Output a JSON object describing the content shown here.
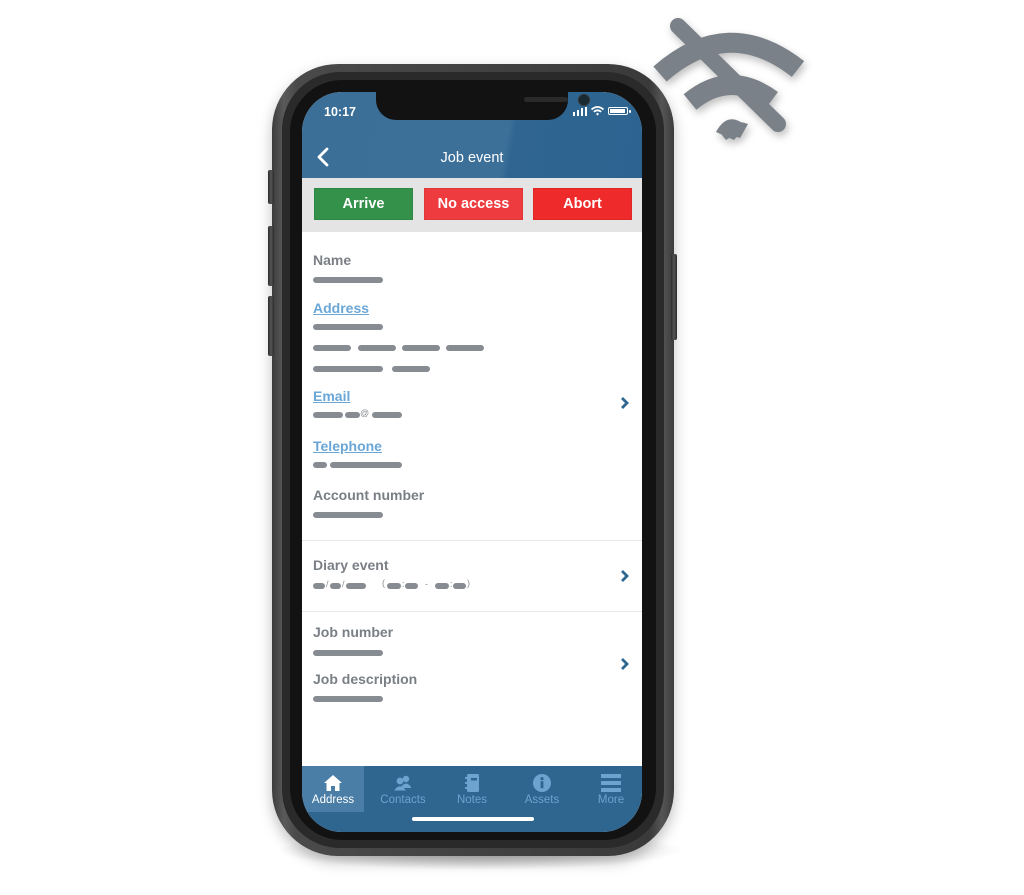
{
  "status_bar": {
    "time": "10:17",
    "icons": [
      "cellular-signal-icon",
      "wifi-icon",
      "battery-icon"
    ]
  },
  "header": {
    "title": "Job event",
    "back_icon": "chevron-left-icon"
  },
  "actions": {
    "arrive": {
      "label": "Arrive",
      "color": "#33914a"
    },
    "no_access": {
      "label": "No access",
      "color": "#ee3b3f"
    },
    "abort": {
      "label": "Abort",
      "color": "#ee2a2a"
    }
  },
  "fields": {
    "name": {
      "label": "Name"
    },
    "address": {
      "label": "Address"
    },
    "email": {
      "label": "Email",
      "at_symbol": "@"
    },
    "telephone": {
      "label": "Telephone"
    },
    "account_number": {
      "label": "Account number"
    },
    "diary_event": {
      "label": "Diary event",
      "open_paren": "(",
      "close_paren": ")",
      "dash": "-",
      "slash": "/",
      "colon": ":"
    },
    "job_number": {
      "label": "Job number"
    },
    "job_description": {
      "label": "Job description"
    }
  },
  "tabbar": {
    "tabs": [
      {
        "label": "Address",
        "icon": "home-icon",
        "active": true
      },
      {
        "label": "Contacts",
        "icon": "contacts-icon",
        "active": false
      },
      {
        "label": "Notes",
        "icon": "notebook-icon",
        "active": false
      },
      {
        "label": "Assets",
        "icon": "info-icon",
        "active": false
      },
      {
        "label": "More",
        "icon": "menu-icon",
        "active": false
      }
    ]
  },
  "overlay": {
    "icon": "wifi-off-icon",
    "color": "#7b8189"
  },
  "colors": {
    "header_blue": "#3b6f97",
    "tabbar_blue": "#2e6690",
    "link_blue": "#6aa6d6",
    "label_grey": "#7a7f86",
    "chevron_blue": "#2e6690"
  }
}
